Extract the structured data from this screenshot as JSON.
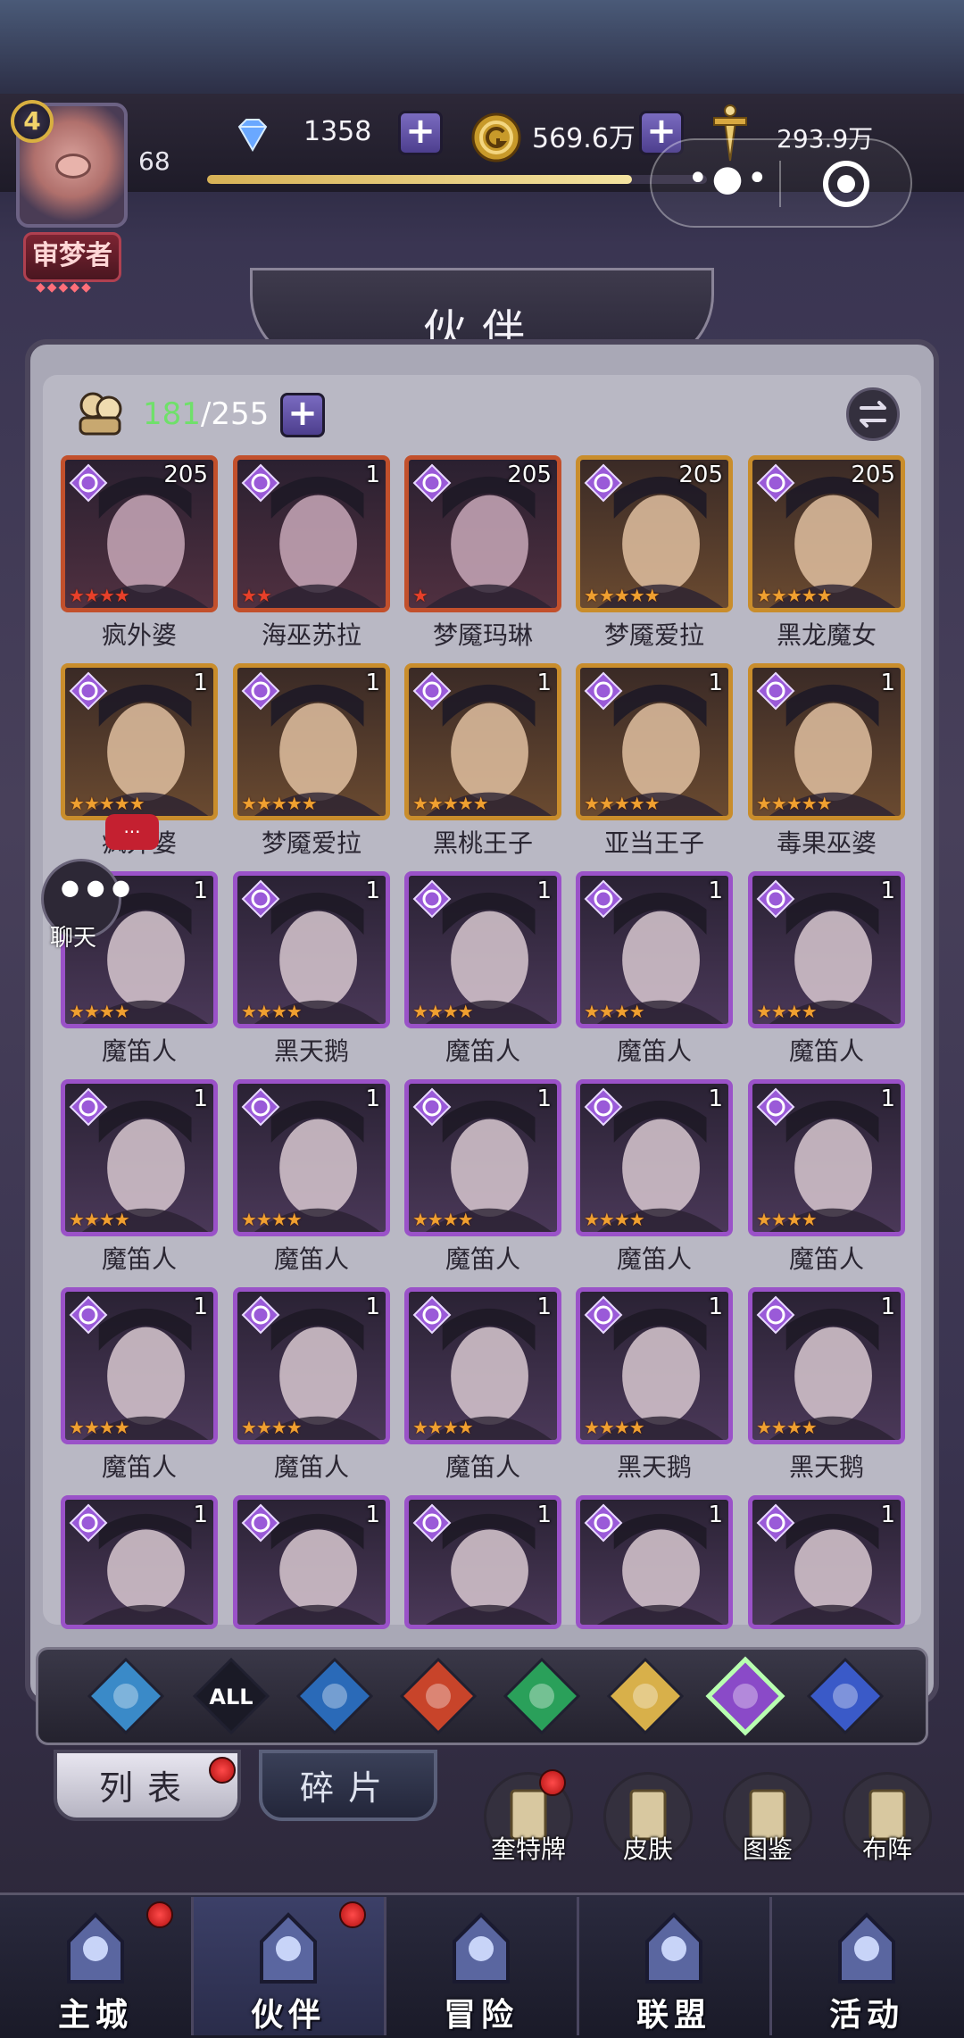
{
  "header": {
    "level_badge": "4",
    "player_level": "68",
    "title_badge": "审梦者",
    "title_dots": "◆◆◆◆◆",
    "resources": {
      "diamonds": "1358",
      "gold": "569.6万",
      "power": "293.9万"
    },
    "xp_progress": 0.85
  },
  "page_title": "伙伴",
  "roster": {
    "owned": "181",
    "capacity": "/255"
  },
  "cards": [
    {
      "name": "疯外婆",
      "count": "205",
      "stars": "★★★★",
      "frame": "red"
    },
    {
      "name": "海巫苏拉",
      "count": "1",
      "stars": "★★",
      "frame": "red"
    },
    {
      "name": "梦魇玛琳",
      "count": "205",
      "stars": "★",
      "frame": "red"
    },
    {
      "name": "梦魇爱拉",
      "count": "205",
      "stars": "★★★★★",
      "frame": "gold"
    },
    {
      "name": "黑龙魔女",
      "count": "205",
      "stars": "★★★★★",
      "frame": "gold"
    },
    {
      "name": "疯外婆",
      "count": "1",
      "stars": "★★★★★",
      "frame": "gold"
    },
    {
      "name": "梦魇爱拉",
      "count": "1",
      "stars": "★★★★★",
      "frame": "gold"
    },
    {
      "name": "黑桃王子",
      "count": "1",
      "stars": "★★★★★",
      "frame": "gold"
    },
    {
      "name": "亚当王子",
      "count": "1",
      "stars": "★★★★★",
      "frame": "gold"
    },
    {
      "name": "毒果巫婆",
      "count": "1",
      "stars": "★★★★★",
      "frame": "gold"
    },
    {
      "name": "魔笛人",
      "count": "1",
      "stars": "★★★★",
      "frame": "purple"
    },
    {
      "name": "黑天鹅",
      "count": "1",
      "stars": "★★★★",
      "frame": "purple"
    },
    {
      "name": "魔笛人",
      "count": "1",
      "stars": "★★★★",
      "frame": "purple"
    },
    {
      "name": "魔笛人",
      "count": "1",
      "stars": "★★★★",
      "frame": "purple"
    },
    {
      "name": "魔笛人",
      "count": "1",
      "stars": "★★★★",
      "frame": "purple"
    },
    {
      "name": "魔笛人",
      "count": "1",
      "stars": "★★★★",
      "frame": "purple"
    },
    {
      "name": "魔笛人",
      "count": "1",
      "stars": "★★★★",
      "frame": "purple"
    },
    {
      "name": "魔笛人",
      "count": "1",
      "stars": "★★★★",
      "frame": "purple"
    },
    {
      "name": "魔笛人",
      "count": "1",
      "stars": "★★★★",
      "frame": "purple"
    },
    {
      "name": "魔笛人",
      "count": "1",
      "stars": "★★★★",
      "frame": "purple"
    },
    {
      "name": "魔笛人",
      "count": "1",
      "stars": "★★★★",
      "frame": "purple"
    },
    {
      "name": "魔笛人",
      "count": "1",
      "stars": "★★★★",
      "frame": "purple"
    },
    {
      "name": "魔笛人",
      "count": "1",
      "stars": "★★★★",
      "frame": "purple"
    },
    {
      "name": "黑天鹅",
      "count": "1",
      "stars": "★★★★",
      "frame": "purple"
    },
    {
      "name": "黑天鹅",
      "count": "1",
      "stars": "★★★★",
      "frame": "purple"
    },
    {
      "name": "",
      "count": "1",
      "stars": "",
      "frame": "purple"
    },
    {
      "name": "",
      "count": "1",
      "stars": "",
      "frame": "purple"
    },
    {
      "name": "",
      "count": "1",
      "stars": "",
      "frame": "purple"
    },
    {
      "name": "",
      "count": "1",
      "stars": "",
      "frame": "purple"
    },
    {
      "name": "",
      "count": "1",
      "stars": "",
      "frame": "purple"
    }
  ],
  "chat": {
    "label": "聊天",
    "bubble": "..."
  },
  "filters": [
    {
      "icon": "water-crest-icon",
      "color": "#3a8ac8"
    },
    {
      "label": "ALL",
      "icon": "all-icon",
      "color": "#1a1a26"
    },
    {
      "icon": "water-drop-icon",
      "color": "#2a6ab8"
    },
    {
      "icon": "fire-icon",
      "color": "#c8442a"
    },
    {
      "icon": "wind-icon",
      "color": "#2aa05a"
    },
    {
      "icon": "light-icon",
      "color": "#d8b04a"
    },
    {
      "icon": "moon-icon",
      "color": "#8a4ac8"
    },
    {
      "icon": "planet-icon",
      "color": "#3a5ac8"
    }
  ],
  "tabs": {
    "list": "列表",
    "fragments": "碎片"
  },
  "actions": [
    {
      "label": "奎特牌",
      "icon": "tarot-card-icon"
    },
    {
      "label": "皮肤",
      "icon": "skin-icon"
    },
    {
      "label": "图鉴",
      "icon": "codex-icon"
    },
    {
      "label": "布阵",
      "icon": "formation-icon"
    }
  ],
  "nav": [
    {
      "label": "主城",
      "icon": "castle-icon"
    },
    {
      "label": "伙伴",
      "icon": "partner-icon"
    },
    {
      "label": "冒险",
      "icon": "adventure-icon"
    },
    {
      "label": "联盟",
      "icon": "alliance-icon"
    },
    {
      "label": "活动",
      "icon": "activity-icon"
    }
  ]
}
